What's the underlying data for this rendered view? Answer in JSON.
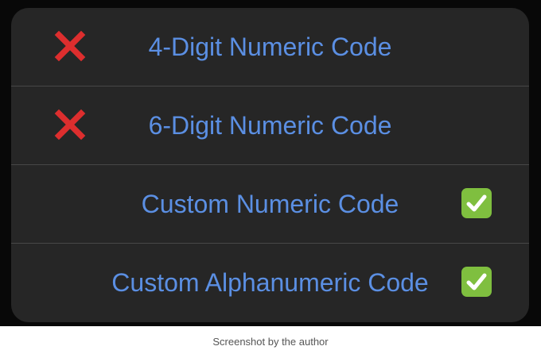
{
  "action_sheet": {
    "options": [
      {
        "label": "4-Digit Numeric Code",
        "status_icon": "red-x-icon",
        "status_color": "#dd2e2e"
      },
      {
        "label": "6-Digit Numeric Code",
        "status_icon": "red-x-icon",
        "status_color": "#dd2e2e"
      },
      {
        "label": "Custom Numeric Code",
        "status_icon": "green-check-icon",
        "status_color": "#7fbf3f"
      },
      {
        "label": "Custom Alphanumeric Code",
        "status_icon": "green-check-icon",
        "status_color": "#7fbf3f"
      }
    ],
    "label_color": "#5b8fe3",
    "background_color": "#262626"
  },
  "caption": "Screenshot by the author"
}
